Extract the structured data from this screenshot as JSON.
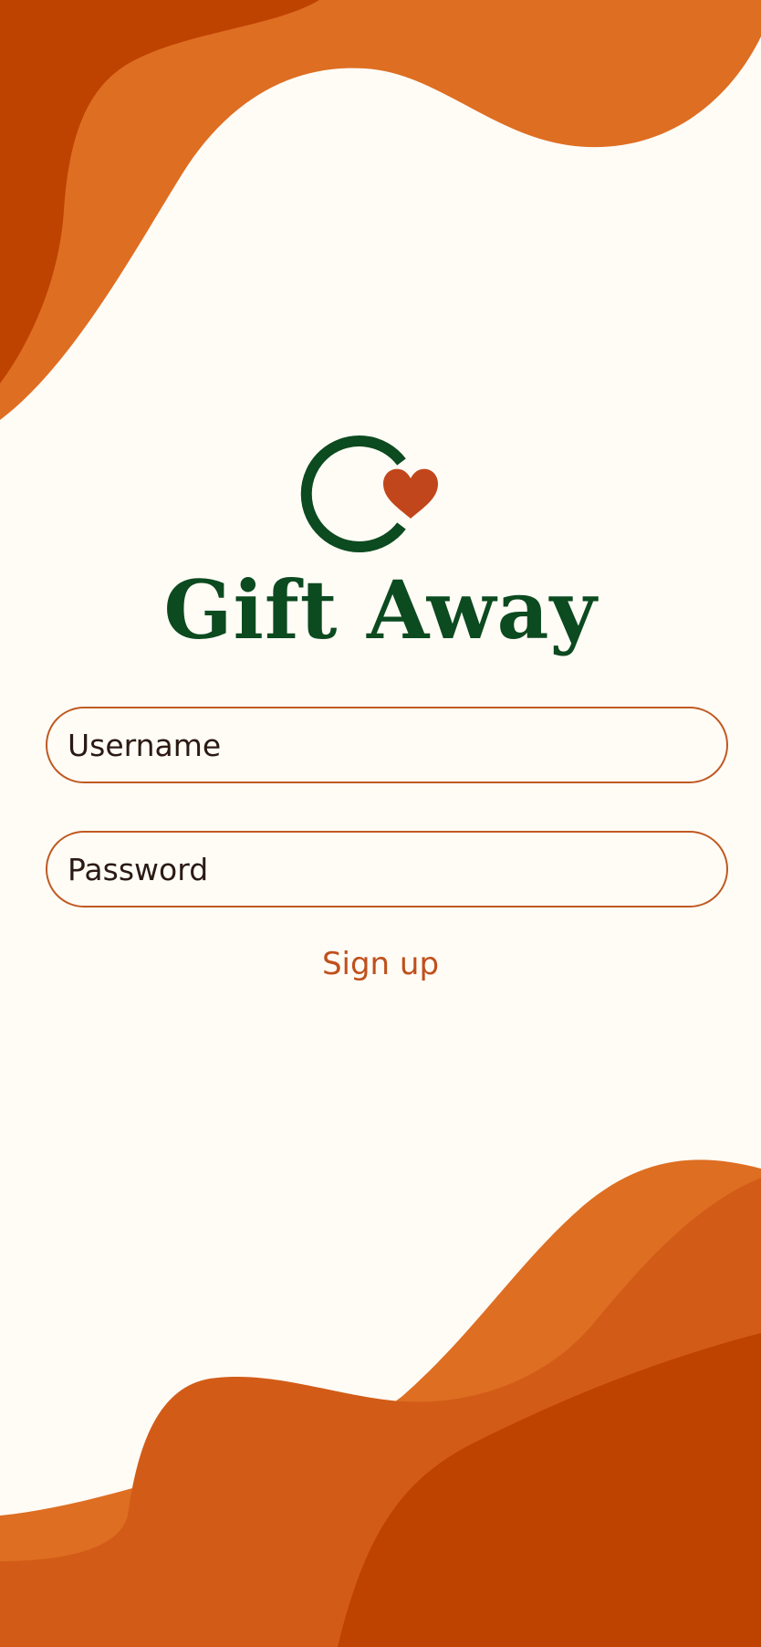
{
  "app": {
    "title": "Gift Away"
  },
  "logo": {
    "icon": "heart-recycle-icon",
    "ring_color": "#0C4A1F",
    "heart_color": "#C2461B"
  },
  "login_form": {
    "username_placeholder": "Username",
    "password_placeholder": "Password",
    "signup_label": "Sign up"
  },
  "colors": {
    "background": "#FFFCF6",
    "brand_green": "#0C4A1F",
    "accent_orange": "#DE6E22",
    "mid_orange": "#D25C17",
    "dark_orange": "#BE4200",
    "link": "#C0501C"
  }
}
